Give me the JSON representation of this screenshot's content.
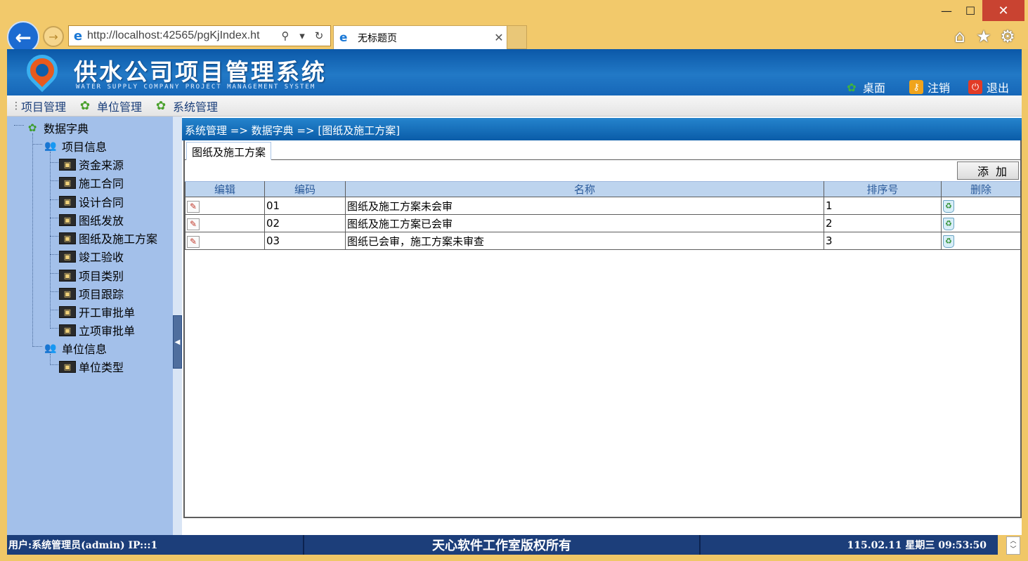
{
  "browser": {
    "url": "http://localhost:42565/pgKjIndex.ht",
    "tab_title": "无标题页",
    "min_glyph": "—",
    "max_glyph": "☐",
    "close_glyph": "✕",
    "back_glyph": "←",
    "forward_glyph": "→",
    "search_glyph": "⚲",
    "dropdown_glyph": "▾",
    "refresh_glyph": "↻",
    "tab_close_glyph": "✕",
    "home_glyph": "⌂",
    "star_glyph": "★",
    "gear_glyph": "⚙"
  },
  "header": {
    "title": "供水公司项目管理系统",
    "subtitle": "WATER SUPPLY COMPANY PROJECT MANAGEMENT SYSTEM",
    "links": {
      "desktop": "桌面",
      "logout": "注销",
      "exit": "退出"
    }
  },
  "menu": {
    "items": [
      "项目管理",
      "单位管理",
      "系统管理"
    ]
  },
  "tree": {
    "root": "数据字典",
    "groups": [
      {
        "label": "项目信息",
        "children": [
          "资金来源",
          "施工合同",
          "设计合同",
          "图纸发放",
          "图纸及施工方案",
          "竣工验收",
          "项目类别",
          "项目跟踪",
          "开工审批单",
          "立项审批单"
        ]
      },
      {
        "label": "单位信息",
        "children": [
          "单位类型"
        ]
      }
    ]
  },
  "breadcrumb": "系统管理 => 数据字典 => [图纸及施工方案]",
  "panel": {
    "tab_label": "图纸及施工方案",
    "add_button": "添加",
    "columns": [
      "编辑",
      "编码",
      "名称",
      "排序号",
      "删除"
    ],
    "rows": [
      {
        "code": "01",
        "name": "图纸及施工方案未会审",
        "order": "1"
      },
      {
        "code": "02",
        "name": "图纸及施工方案已会审",
        "order": "2"
      },
      {
        "code": "03",
        "name": "图纸已会审，施工方案未审查",
        "order": "3"
      }
    ]
  },
  "status": {
    "user": "用户:系统管理员(admin) IP:::1",
    "copyright": "天心软件工作室版权所有",
    "datetime": "115.02.11  星期三  09:53:50"
  },
  "colors": {
    "header_blue": "#0b58a8",
    "sidebar_blue": "#a3c0ea",
    "status_navy": "#1c3e7a",
    "chrome_gold": "#f2c96b"
  }
}
